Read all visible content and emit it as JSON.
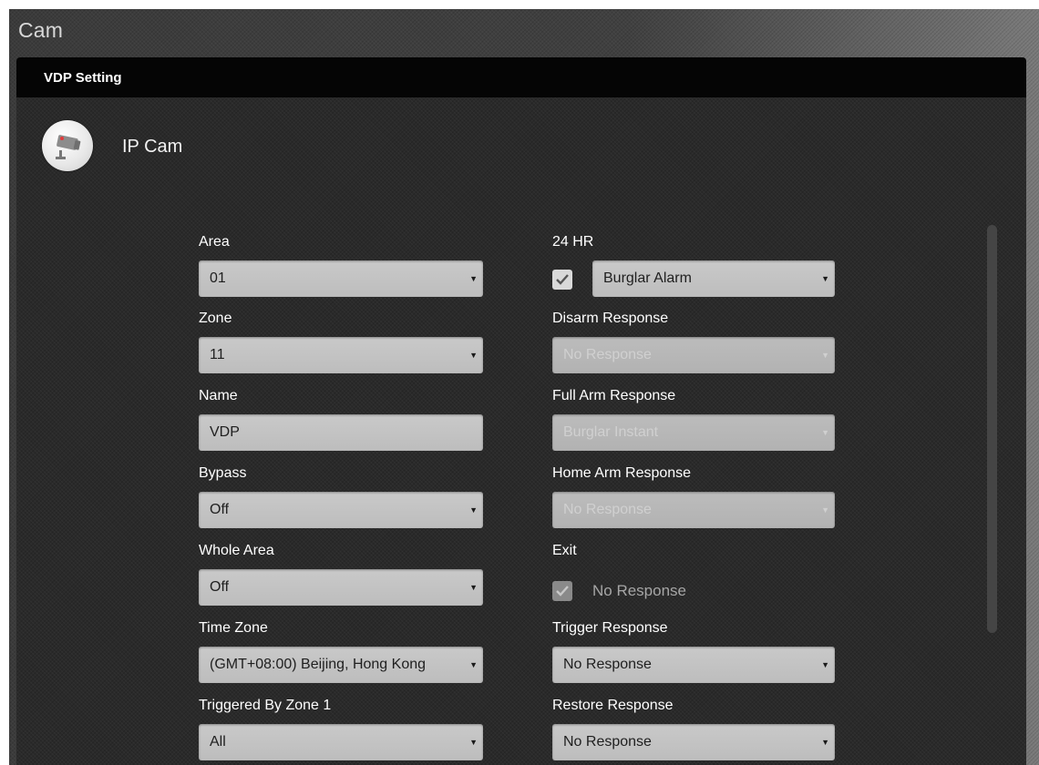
{
  "window": {
    "title": "Cam"
  },
  "panel": {
    "title": "VDP Setting"
  },
  "device": {
    "name": "IP Cam",
    "icon": "camera-icon"
  },
  "left_column": {
    "area": {
      "label": "Area",
      "value": "01"
    },
    "zone": {
      "label": "Zone",
      "value": "11"
    },
    "name": {
      "label": "Name",
      "value": "VDP"
    },
    "bypass": {
      "label": "Bypass",
      "value": "Off"
    },
    "whole_area": {
      "label": "Whole Area",
      "value": "Off"
    },
    "time_zone": {
      "label": "Time Zone",
      "value": "(GMT+08:00) Beijing, Hong Kong"
    },
    "triggered_by_zone": {
      "label": "Triggered By Zone 1",
      "value": "All"
    }
  },
  "right_column": {
    "hr24": {
      "label": "24 HR",
      "checked": true,
      "value": "Burglar Alarm"
    },
    "disarm_response": {
      "label": "Disarm Response",
      "value": "No Response",
      "disabled": true
    },
    "full_arm_response": {
      "label": "Full Arm Response",
      "value": "Burglar Instant",
      "disabled": true
    },
    "home_arm_response": {
      "label": "Home Arm Response",
      "value": "No Response",
      "disabled": true
    },
    "exit": {
      "label": "Exit",
      "checked": true,
      "text": "No Response",
      "disabled": true
    },
    "trigger_response": {
      "label": "Trigger Response",
      "value": "No Response"
    },
    "restore_response": {
      "label": "Restore Response",
      "value": "No Response"
    }
  },
  "colors": {
    "header_bg": "#050505",
    "panel_bg": "#2a2a2a",
    "field_bg": "#c4c4c4",
    "text": "#ffffff"
  }
}
